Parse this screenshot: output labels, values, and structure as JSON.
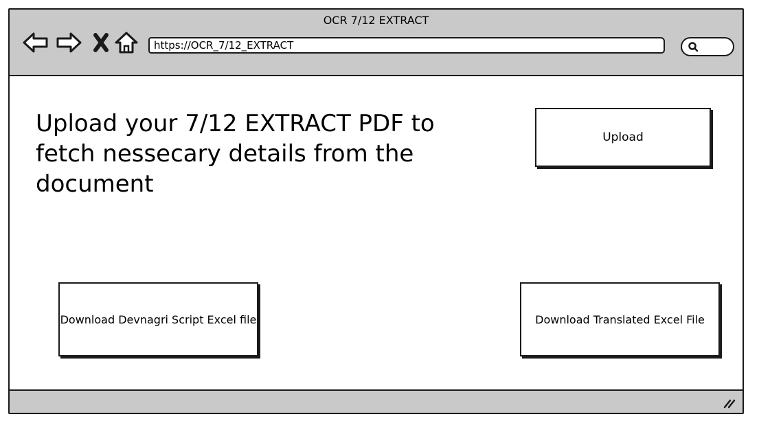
{
  "window": {
    "title": "OCR 7/12 EXTRACT"
  },
  "toolbar": {
    "url": "https://OCR_7/12_EXTRACT",
    "icons": [
      "back-arrow-icon",
      "forward-arrow-icon",
      "close-x-icon",
      "home-icon",
      "search-icon"
    ]
  },
  "main": {
    "heading": "Upload your 7/12 EXTRACT PDF to fetch nessecary details from the document",
    "upload_label": "Upload",
    "download_devnagri_label": "Download Devnagri Script Excel file",
    "download_translated_label": "Download Translated Excel File"
  },
  "colors": {
    "chrome": "#c9c9c9",
    "border": "#1a1a1a",
    "background": "#ffffff"
  }
}
